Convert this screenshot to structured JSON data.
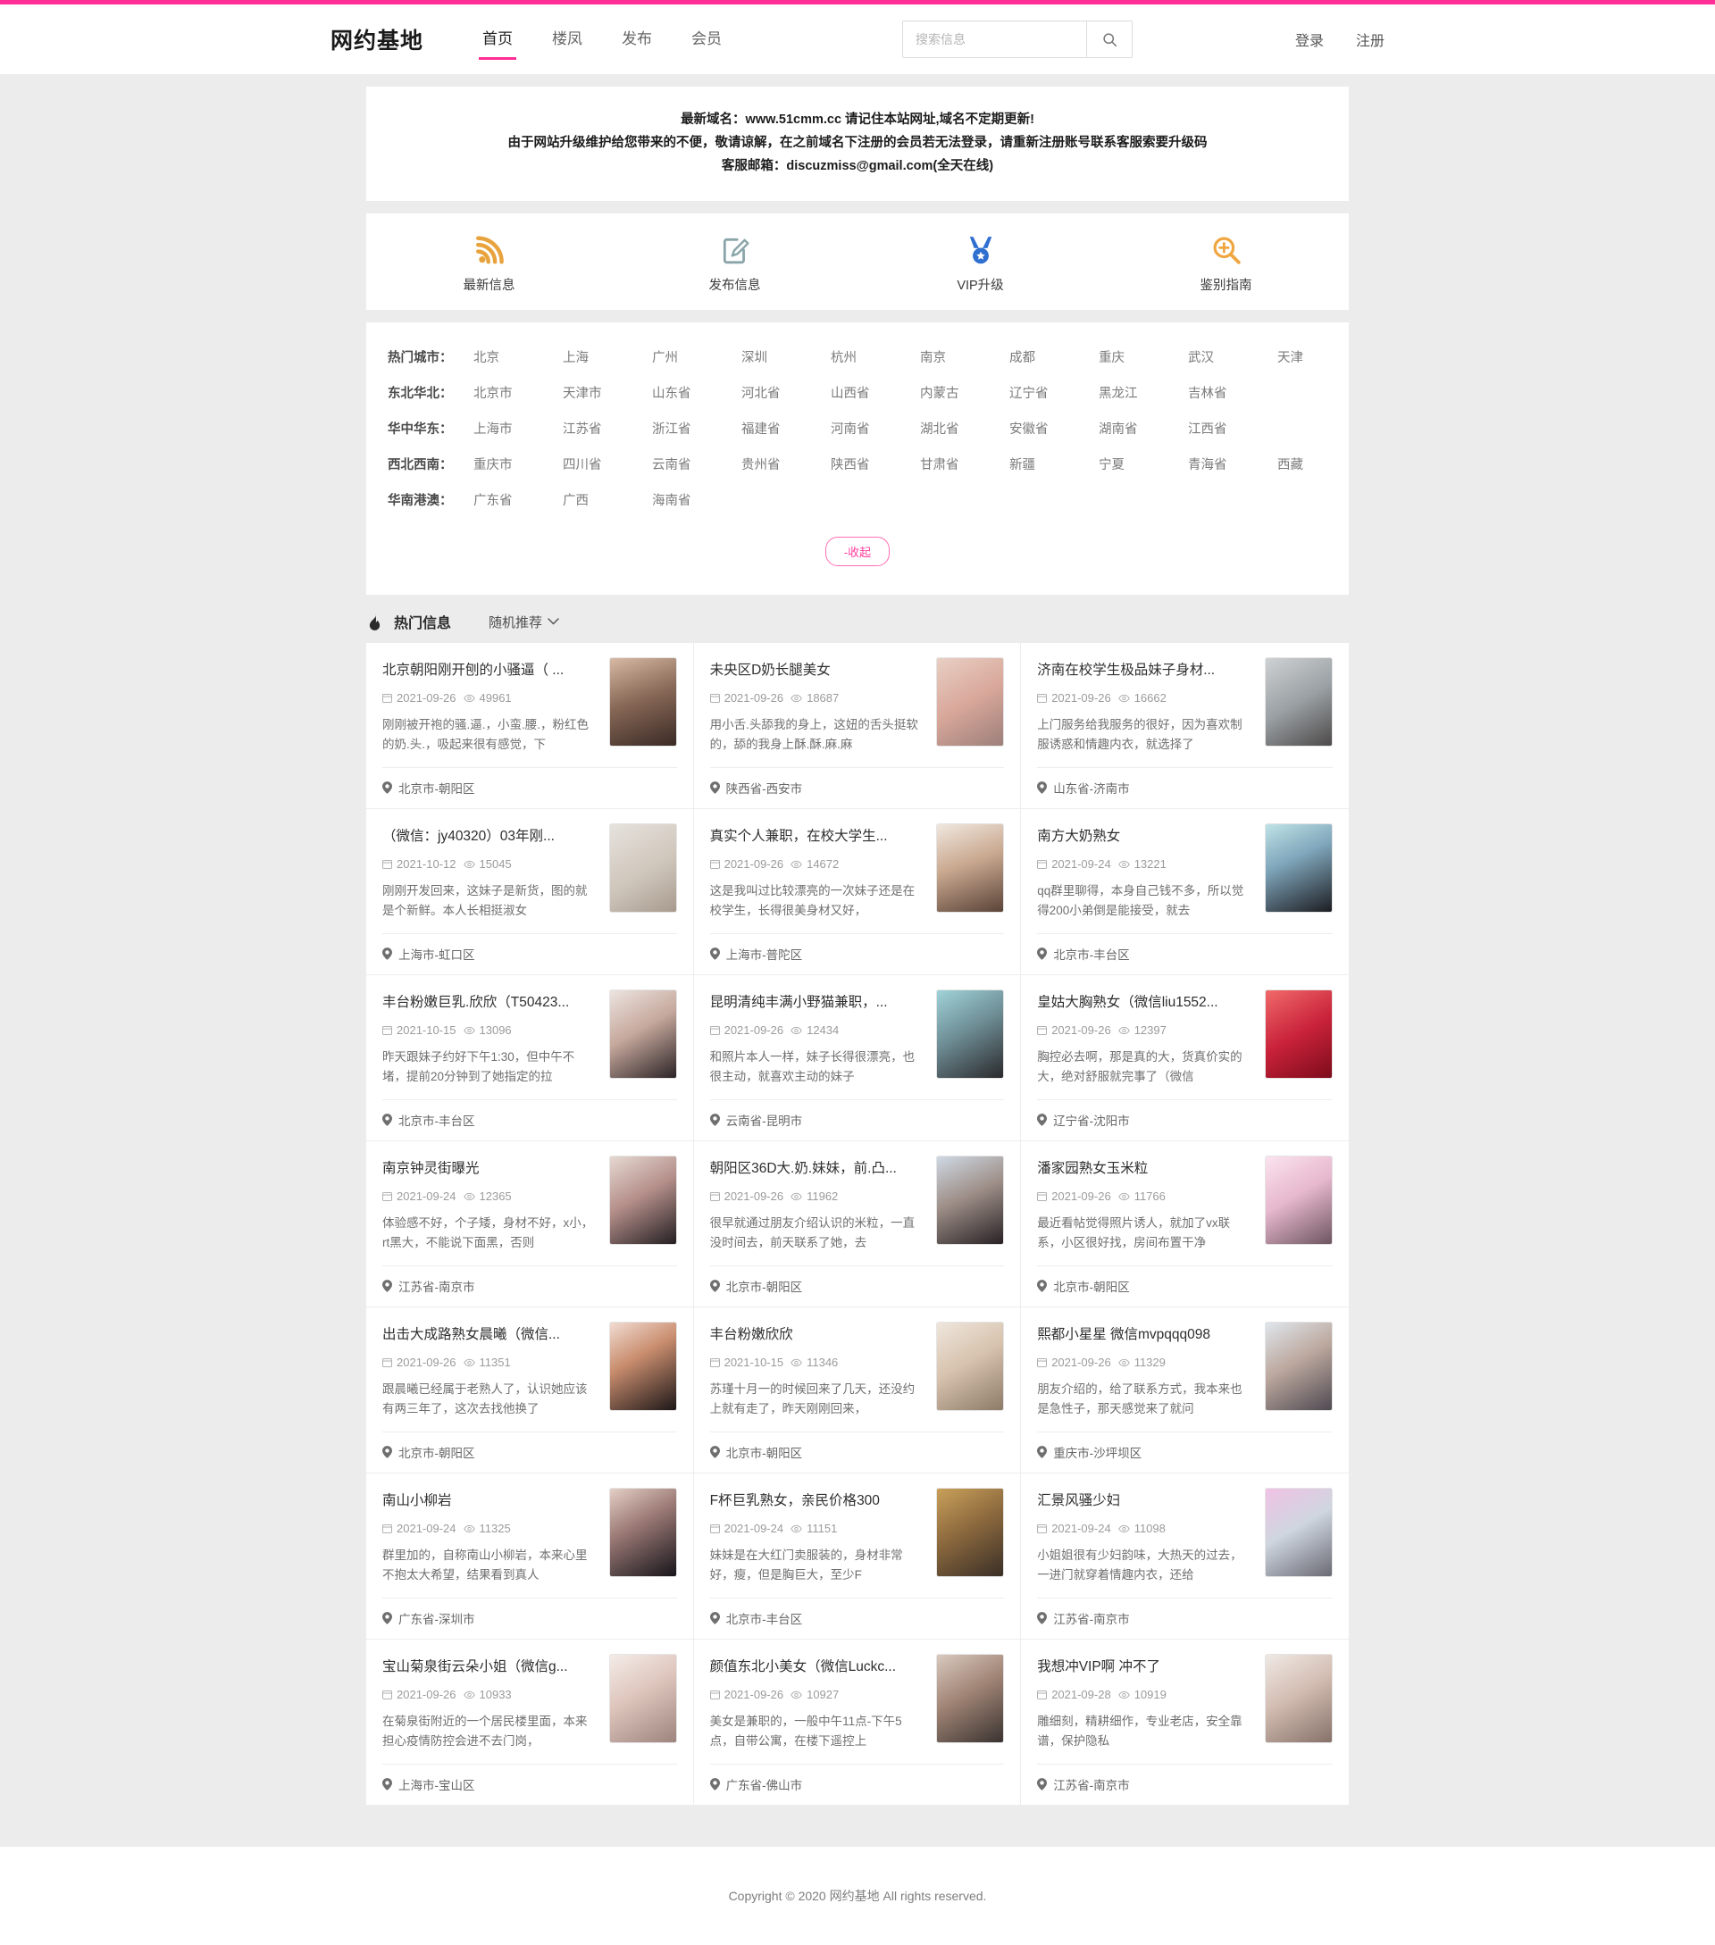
{
  "header": {
    "brand": "网约基地",
    "nav": [
      {
        "label": "首页",
        "active": true
      },
      {
        "label": "楼凤",
        "active": false
      },
      {
        "label": "发布",
        "active": false
      },
      {
        "label": "会员",
        "active": false
      }
    ],
    "search_placeholder": "搜索信息",
    "search_value": "",
    "login_label": "登录",
    "register_label": "注册"
  },
  "notice": {
    "lines": [
      "最新域名：www.51cmm.cc 请记住本站网址,域名不定期更新!",
      "由于网站升级维护给您带来的不便，敬请谅解，在之前域名下注册的会员若无法登录，请重新注册账号联系客服索要升级码",
      "客服邮箱：discuzmiss@gmail.com(全天在线)"
    ]
  },
  "quicknav": [
    {
      "label": "最新信息",
      "icon": "rss-icon",
      "color": "#e8a33d"
    },
    {
      "label": "发布信息",
      "icon": "edit-icon",
      "color": "#8aa5a9"
    },
    {
      "label": "VIP升级",
      "icon": "medal-icon",
      "color": "#2f6fd0"
    },
    {
      "label": "鉴别指南",
      "icon": "zoom-search-icon",
      "color": "#f0a640"
    }
  ],
  "cities": {
    "rows": [
      {
        "key": "热门城市：",
        "items": [
          "北京",
          "上海",
          "广州",
          "深圳",
          "杭州",
          "南京",
          "成都",
          "重庆",
          "武汉",
          "天津"
        ]
      },
      {
        "key": "东北华北：",
        "items": [
          "北京市",
          "天津市",
          "山东省",
          "河北省",
          "山西省",
          "内蒙古",
          "辽宁省",
          "黑龙江",
          "吉林省"
        ]
      },
      {
        "key": "华中华东：",
        "items": [
          "上海市",
          "江苏省",
          "浙江省",
          "福建省",
          "河南省",
          "湖北省",
          "安徽省",
          "湖南省",
          "江西省"
        ]
      },
      {
        "key": "西北西南：",
        "items": [
          "重庆市",
          "四川省",
          "云南省",
          "贵州省",
          "陕西省",
          "甘肃省",
          "新疆",
          "宁夏",
          "青海省",
          "西藏"
        ]
      },
      {
        "key": "华南港澳：",
        "items": [
          "广东省",
          "广西",
          "海南省"
        ]
      }
    ],
    "collapse_label": "-收起"
  },
  "section": {
    "title": "热门信息",
    "filter_label": "随机推荐"
  },
  "cards": [
    {
      "title": "北京朝阳刚开刨的小骚逼（ ...",
      "date": "2021-09-26",
      "views": "49961",
      "desc": "刚刚被开袍的骚.逼.，小蛮.腰.，粉红色的奶.头.，吸起来很有感觉，下",
      "location": "北京市-朝阳区",
      "thumb": "linear-gradient(160deg,#d7b9a4 0%,#8a6a58 45%,#3a2a25 100%)"
    },
    {
      "title": "未央区D奶长腿美女",
      "date": "2021-09-26",
      "views": "18687",
      "desc": "用小舌.头舔我的身上，这妞的舌头挺软的，舔的我身上酥.酥.麻.麻",
      "location": "陕西省-西安市",
      "thumb": "linear-gradient(150deg,#e9cfc4 0%,#d8a79a 50%,#9c7f7a 100%)"
    },
    {
      "title": "济南在校学生极品妹子身材...",
      "date": "2021-09-26",
      "views": "16662",
      "desc": "上门服务给我服务的很好，因为喜欢制服诱惑和情趣内衣，就选择了",
      "location": "山东省-济南市",
      "thumb": "linear-gradient(150deg,#cfd2d4 0%,#9aa0a4 50%,#4d4a49 100%)"
    },
    {
      "title": "（微信：jy40320）03年刚...",
      "date": "2021-10-12",
      "views": "15045",
      "desc": "刚刚开发回来，这妹子是新货，图的就是个新鲜。本人长相挺淑女",
      "location": "上海市-虹口区",
      "thumb": "linear-gradient(150deg,#e6e2dd 0%,#cfc6bb 55%,#a79a8d 100%)"
    },
    {
      "title": "真实个人兼职，在校大学生...",
      "date": "2021-09-26",
      "views": "14672",
      "desc": "这是我叫过比较漂亮的一次妹子还是在校学生，长得很美身材又好，",
      "location": "上海市-普陀区",
      "thumb": "linear-gradient(160deg,#f0e7df 0%,#c9a88f 45%,#5a4338 100%)"
    },
    {
      "title": "南方大奶熟女",
      "date": "2021-09-24",
      "views": "13221",
      "desc": "qq群里聊得，本身自己钱不多，所以觉得200小弟倒是能接受，就去",
      "location": "北京市-丰台区",
      "thumb": "linear-gradient(155deg,#bfe3e6 0%,#7fa6bb 40%,#1d1d22 100%)"
    },
    {
      "title": "丰台粉嫩巨乳.欣欣（T50423...",
      "date": "2021-10-15",
      "views": "13096",
      "desc": "昨天跟妹子约好下午1:30，但中午不堵，提前20分钟到了她指定的拉",
      "location": "北京市-丰台区",
      "thumb": "linear-gradient(150deg,#ece4e0 0%,#c6a89c 45%,#2b2326 100%)"
    },
    {
      "title": "昆明清纯丰满小野猫兼职，...",
      "date": "2021-09-26",
      "views": "12434",
      "desc": "和照片本人一样，妹子长得很漂亮，也很主动，就喜欢主动的妹子",
      "location": "云南省-昆明市",
      "thumb": "linear-gradient(150deg,#9fd3d8 0%,#6f8e96 45%,#2a2a2c 100%)"
    },
    {
      "title": "皇姑大胸熟女（微信liu1552...",
      "date": "2021-09-26",
      "views": "12397",
      "desc": "胸控必去啊，那是真的大，货真价实的大，绝对舒服就完事了（微信",
      "location": "辽宁省-沈阳市",
      "thumb": "linear-gradient(150deg,#f06a6a 0%,#c9223a 50%,#7d0c1b 100%)"
    },
    {
      "title": "南京钟灵街曝光",
      "date": "2021-09-24",
      "views": "12365",
      "desc": "体验感不好，个子矮，身材不好，x小，rt黑大，不能说下面黑，否则",
      "location": "江苏省-南京市",
      "thumb": "linear-gradient(150deg,#e6d9d2 0%,#b58f8a 45%,#241f22 100%)"
    },
    {
      "title": "朝阳区36D大.奶.妹妹，前.凸...",
      "date": "2021-09-26",
      "views": "11962",
      "desc": "很早就通过朋友介绍认识的米粒，一直没时间去，前天联系了她，去",
      "location": "北京市-朝阳区",
      "thumb": "linear-gradient(155deg,#cfd9e4 0%,#9e8f88 45%,#282225 100%)"
    },
    {
      "title": "潘家园熟女玉米粒",
      "date": "2021-09-26",
      "views": "11766",
      "desc": "最近看帖觉得照片诱人，就加了vx联系，小区很好找，房间布置干净",
      "location": "北京市-朝阳区",
      "thumb": "linear-gradient(150deg,#fbe3ee 0%,#e7b8ce 45%,#6d5560 100%)"
    },
    {
      "title": "出击大成路熟女晨曦（微信...",
      "date": "2021-09-26",
      "views": "11351",
      "desc": "跟晨曦已经属于老熟人了，认识她应该有两三年了，这次去找他换了",
      "location": "北京市-朝阳区",
      "thumb": "linear-gradient(150deg,#f1dcd2 0%,#c98d6e 40%,#1d1718 100%)"
    },
    {
      "title": "丰台粉嫩欣欣",
      "date": "2021-10-15",
      "views": "11346",
      "desc": "苏瑾十月一的时候回来了几天，还没约上就有走了，昨天刚刚回来，",
      "location": "北京市-朝阳区",
      "thumb": "linear-gradient(150deg,#efe6dd 0%,#d7c3ae 45%,#8d7a68 100%)"
    },
    {
      "title": "熙都小星星 微信mvpqqq098",
      "date": "2021-09-26",
      "views": "11329",
      "desc": "朋友介绍的，给了联系方式，我本来也是急性子，那天感觉来了就问",
      "location": "重庆市-沙坪坝区",
      "thumb": "linear-gradient(150deg,#dfe6ec 0%,#bca89e 45%,#4f4a52 100%)"
    },
    {
      "title": "南山小柳岩",
      "date": "2021-09-24",
      "views": "11325",
      "desc": "群里加的，自称南山小柳岩，本来心里不抱太大希望，结果看到真人",
      "location": "广东省-深圳市",
      "thumb": "linear-gradient(150deg,#e4cfc6 0%,#9d7b77 40%,#17151a 100%)"
    },
    {
      "title": "F杯巨乳熟女，亲民价格300",
      "date": "2021-09-24",
      "views": "11151",
      "desc": "妹妹是在大红门卖服装的，身材非常好，瘦，但是胸巨大，至少F",
      "location": "北京市-丰台区",
      "thumb": "linear-gradient(150deg,#c9a05a 0%,#8d6a3e 45%,#3a2f27 100%)"
    },
    {
      "title": "汇景风骚少妇",
      "date": "2021-09-24",
      "views": "11098",
      "desc": "小姐姐很有少妇韵味，大热天的过去，一进门就穿着情趣内衣，还给",
      "location": "江苏省-南京市",
      "thumb": "linear-gradient(150deg,#f0c2e4 0%,#cfd6e0 45%,#6a6a74 100%)"
    },
    {
      "title": "宝山菊泉街云朵小姐（微信g...",
      "date": "2021-09-26",
      "views": "10933",
      "desc": "在菊泉街附近的一个居民楼里面，本来担心疫情防控会进不去门岗，",
      "location": "上海市-宝山区",
      "thumb": "linear-gradient(150deg,#f4ece8 0%,#ddc4bb 45%,#9d857e 100%)"
    },
    {
      "title": "颜值东北小美女（微信Luckc...",
      "date": "2021-09-26",
      "views": "10927",
      "desc": "美女是兼职的，一般中午11点-下午5点，自带公寓，在楼下遥控上",
      "location": "广东省-佛山市",
      "thumb": "linear-gradient(150deg,#d9c9bf 0%,#a08475 45%,#3a3330 100%)"
    },
    {
      "title": "我想冲VIP啊 冲不了",
      "date": "2021-09-28",
      "views": "10919",
      "desc": "雕细刻，精耕细作，专业老店，安全靠谱，保护隐私",
      "location": "江苏省-南京市",
      "thumb": "linear-gradient(150deg,#efe9e4 0%,#d3bdb2 45%,#87726a 100%)"
    }
  ],
  "footer": {
    "text": "Copyright © 2020 网约基地 All rights reserved."
  }
}
